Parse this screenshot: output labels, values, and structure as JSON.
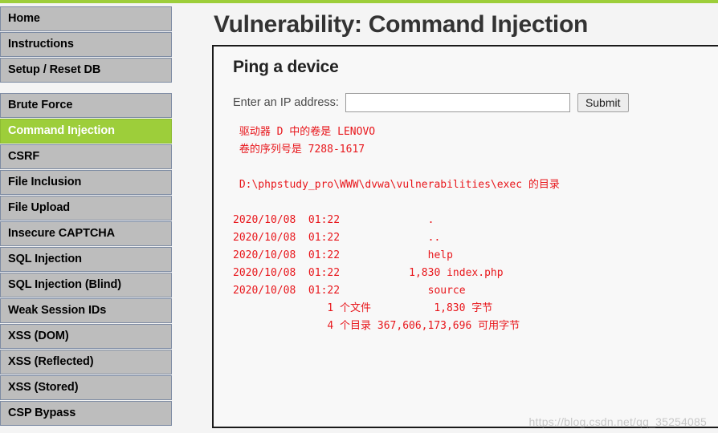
{
  "theme": {
    "accent_green": "#9dce3a",
    "nav_gray": "#bdbdbd",
    "nav_border": "#7d8ba3",
    "output_red": "#e8161b",
    "page_background": "#f4f4f4",
    "panel_background": "#f8f8f8",
    "panel_border": "#1a1a1a",
    "title_color": "#333333"
  },
  "sidebar": {
    "groups": [
      {
        "items": [
          {
            "label": "Home",
            "active": false
          },
          {
            "label": "Instructions",
            "active": false
          },
          {
            "label": "Setup / Reset DB",
            "active": false
          }
        ]
      },
      {
        "items": [
          {
            "label": "Brute Force",
            "active": false
          },
          {
            "label": "Command Injection",
            "active": true
          },
          {
            "label": "CSRF",
            "active": false
          },
          {
            "label": "File Inclusion",
            "active": false
          },
          {
            "label": "File Upload",
            "active": false
          },
          {
            "label": "Insecure CAPTCHA",
            "active": false
          },
          {
            "label": "SQL Injection",
            "active": false
          },
          {
            "label": "SQL Injection (Blind)",
            "active": false
          },
          {
            "label": "Weak Session IDs",
            "active": false
          },
          {
            "label": "XSS (DOM)",
            "active": false
          },
          {
            "label": "XSS (Reflected)",
            "active": false
          },
          {
            "label": "XSS (Stored)",
            "active": false
          },
          {
            "label": "CSP Bypass",
            "active": false
          }
        ]
      }
    ]
  },
  "main": {
    "page_title": "Vulnerability: Command Injection",
    "panel_heading": "Ping a device",
    "form": {
      "ip_label": "Enter an IP address:",
      "ip_value": "",
      "ip_placeholder": "",
      "submit_label": "Submit"
    },
    "command_output": " 驱动器 D 中的卷是 LENOVO\n 卷的序列号是 7288-1617\n\n D:\\phpstudy_pro\\WWW\\dvwa\\vulnerabilities\\exec 的目录\n\n2020/10/08  01:22              .\n2020/10/08  01:22              ..\n2020/10/08  01:22              help\n2020/10/08  01:22           1,830 index.php\n2020/10/08  01:22              source\n               1 个文件          1,830 字节\n               4 个目录 367,606,173,696 可用字节"
  },
  "watermark": {
    "text": "https://blog.csdn.net/qq_35254085"
  }
}
